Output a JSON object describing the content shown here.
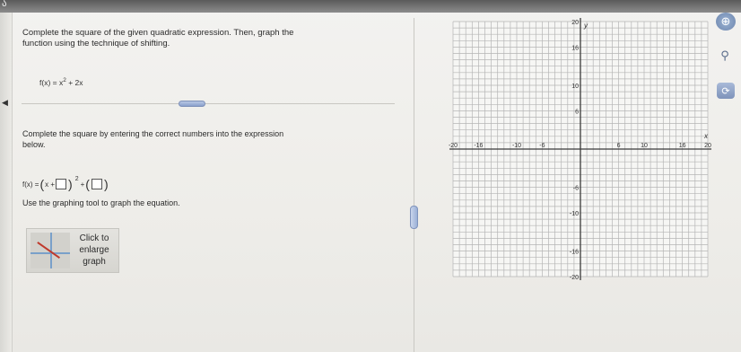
{
  "question": {
    "line1": "Complete the square of the given quadratic expression. Then, graph the",
    "line2": "function using the technique of shifting.",
    "fx_lhs": "f(x) = x",
    "fx_exp": "2",
    "fx_rhs": " + 2x"
  },
  "instruction": {
    "line1": "Complete the square by entering the correct numbers into the expression",
    "line2": "below."
  },
  "answer": {
    "lhs": "f(x) = ",
    "x_plus": "x +",
    "exponent": "2",
    "plus": "+",
    "box1_value": "",
    "box2_value": ""
  },
  "use_tool": "Use the graphing tool to graph the equation.",
  "enlarge": {
    "line1": "Click to",
    "line2": "enlarge",
    "line3": "graph"
  },
  "graph": {
    "x_axis_label": "x",
    "y_axis_label": "y",
    "x_ticks": [
      "-20",
      "-16",
      "-10",
      "-6",
      "6",
      "10",
      "16",
      "20"
    ],
    "y_ticks": [
      "20",
      "16",
      "10",
      "6",
      "-6",
      "-10",
      "-16",
      "-20"
    ],
    "x_range": [
      -20,
      20
    ],
    "y_range": [
      -20,
      20
    ],
    "grid": true,
    "axis_color": "#3a3a3a",
    "grid_color": "#b5b5b5"
  },
  "side_icons": [
    "zoom-in-icon",
    "zoom-out-icon",
    "reset-icon"
  ]
}
